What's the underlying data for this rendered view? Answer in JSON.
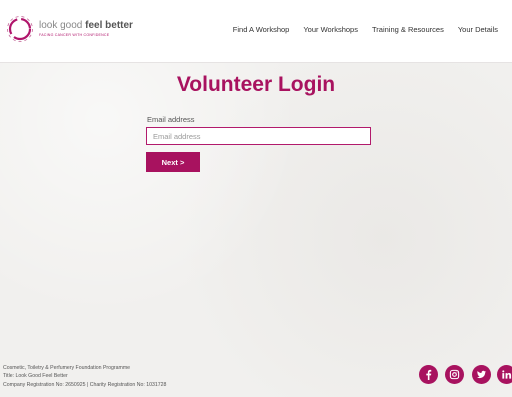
{
  "header": {
    "logo": {
      "name_light": "look good ",
      "name_bold": "feel better",
      "tagline": "FACING CANCER WITH CONFIDENCE"
    },
    "nav": [
      {
        "label": "Find A Workshop"
      },
      {
        "label": "Your Workshops"
      },
      {
        "label": "Training & Resources"
      },
      {
        "label": "Your Details"
      }
    ]
  },
  "main": {
    "title": "Volunteer Login",
    "email": {
      "label": "Email address",
      "placeholder": "Email address",
      "value": ""
    },
    "next_label": "Next >"
  },
  "footer": {
    "lines": [
      "Cosmetic, Toiletry & Perfumery Foundation Programme",
      "Title: Look Good Feel Better",
      "Company Registration No: 2650925 | Charity Registration No: 1031728"
    ],
    "social": [
      "facebook-icon",
      "instagram-icon",
      "twitter-icon",
      "linkedin-icon"
    ]
  },
  "colors": {
    "brand": "#a8125f",
    "background": "#f1f0ee"
  }
}
